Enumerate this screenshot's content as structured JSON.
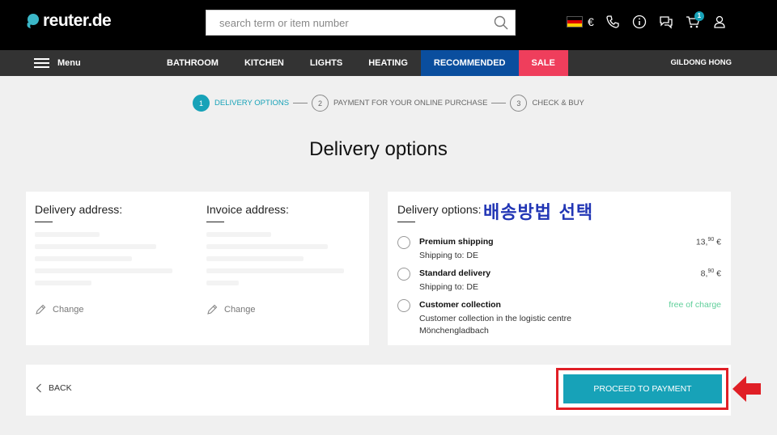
{
  "header": {
    "logo_text": "reuter.de",
    "search": {
      "placeholder": "search term or item number"
    },
    "currency": "€",
    "cart_count": "1",
    "icons": [
      "flag-de-icon",
      "phone-icon",
      "info-icon",
      "chat-icon",
      "cart-icon",
      "user-icon"
    ]
  },
  "nav": {
    "menu_label": "Menu",
    "items": [
      {
        "label": "BATHROOM"
      },
      {
        "label": "KITCHEN"
      },
      {
        "label": "LIGHTS"
      },
      {
        "label": "HEATING"
      },
      {
        "label": "RECOMMENDED"
      },
      {
        "label": "SALE"
      }
    ],
    "user_name": "GILDONG HONG"
  },
  "stepper": {
    "steps": [
      {
        "num": "1",
        "label": "DELIVERY OPTIONS",
        "active": true
      },
      {
        "num": "2",
        "label": "PAYMENT FOR YOUR ONLINE PURCHASE",
        "active": false
      },
      {
        "num": "3",
        "label": "CHECK & BUY",
        "active": false
      }
    ]
  },
  "page_title": "Delivery options",
  "address": {
    "delivery_heading": "Delivery address:",
    "invoice_heading": "Invoice address:",
    "change_label": "Change"
  },
  "delivery": {
    "heading": "Delivery options:",
    "annotation": "배송방법 선택",
    "options": [
      {
        "title": "Premium shipping",
        "sub": "Shipping to: DE",
        "price_main": "13,",
        "price_cents": "90",
        "price_currency": " €"
      },
      {
        "title": "Standard delivery",
        "sub": "Shipping to: DE",
        "price_main": "8,",
        "price_cents": "90",
        "price_currency": " €"
      },
      {
        "title": "Customer collection",
        "sub": "Customer collection in the logistic centre Mönchengladbach",
        "free": "free of charge"
      }
    ]
  },
  "footer": {
    "back_label": "BACK",
    "proceed_label": "PROCEED TO PAYMENT"
  },
  "colors": {
    "accent": "#17a2b8",
    "recommended": "#0a4e9e",
    "sale": "#ef3e5c",
    "annotation": "#e01f26",
    "korean_label": "#2236b5"
  }
}
